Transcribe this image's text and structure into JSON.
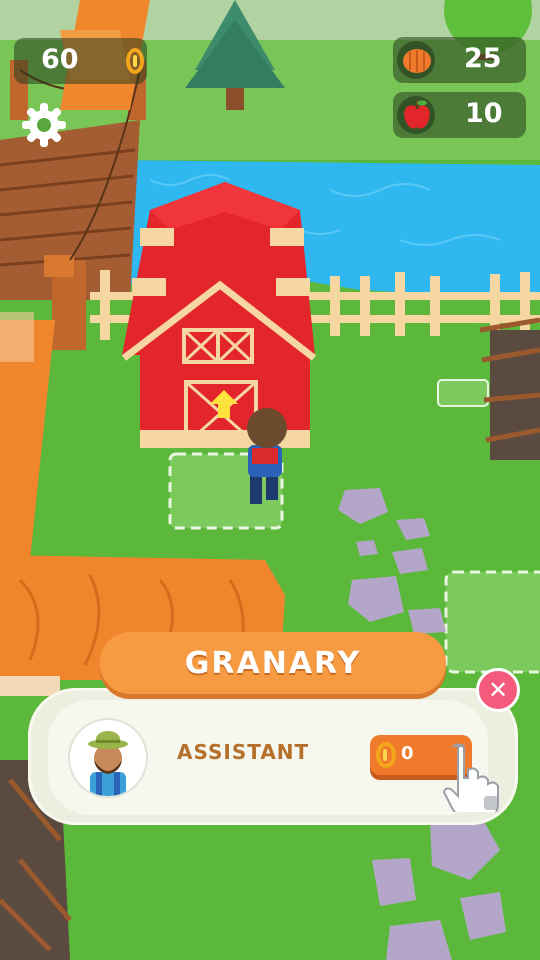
{
  "hud": {
    "coins": "60",
    "pumpkins": "25",
    "apples": "10",
    "icons": {
      "coin": "coin-icon",
      "pumpkin": "pumpkin-icon",
      "apple": "apple-icon",
      "settings": "gear-icon"
    }
  },
  "panel": {
    "title": "GRANARY",
    "assistant_label": "ASSISTANT",
    "hire_cost": "0",
    "close_icon": "close-icon"
  },
  "colors": {
    "grass": "#5bb83a",
    "water": "#2fb7f0",
    "barn_red": "#e3262c",
    "panel_orange": "#f79b43",
    "button_orange": "#f07a2c",
    "close_pink": "#f45a7c",
    "label_brown": "#b5702b"
  }
}
